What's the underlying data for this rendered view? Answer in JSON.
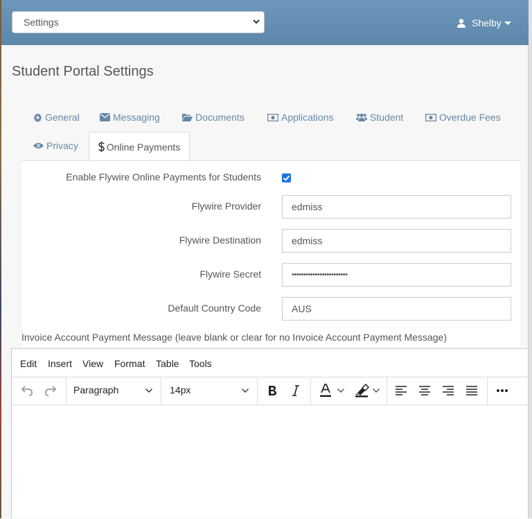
{
  "header": {
    "select_value": "Settings",
    "user_name": "Shelby"
  },
  "page_title": "Student Portal Settings",
  "tabs": [
    {
      "label": "General",
      "icon": "gear-icon"
    },
    {
      "label": "Messaging",
      "icon": "envelope-icon"
    },
    {
      "label": "Documents",
      "icon": "folder-open-icon"
    },
    {
      "label": "Applications",
      "icon": "money-icon"
    },
    {
      "label": "Student",
      "icon": "users-icon"
    },
    {
      "label": "Overdue Fees",
      "icon": "money-icon"
    },
    {
      "label": "Privacy",
      "icon": "eye-icon"
    },
    {
      "label": "Online Payments",
      "icon": "dollar-icon",
      "active": true
    }
  ],
  "form": {
    "enable_label": "Enable Flywire Online Payments for Students",
    "enable_checked": true,
    "provider_label": "Flywire Provider",
    "provider_value": "edmiss",
    "destination_label": "Flywire Destination",
    "destination_value": "edmiss",
    "secret_label": "Flywire Secret",
    "secret_value": "••••••••••••••••••••••••",
    "country_label": "Default Country Code",
    "country_value": "AUS",
    "message_label": "Invoice Account Payment Message (leave blank or clear for no Invoice Account Payment Message)"
  },
  "editor": {
    "menu": [
      "Edit",
      "Insert",
      "View",
      "Format",
      "Table",
      "Tools"
    ],
    "block_format": "Paragraph",
    "font_size": "14px",
    "accent_color": "#1a73e8"
  },
  "colors": {
    "header_bg": "#6489ad",
    "tab_link": "#6688a8"
  }
}
